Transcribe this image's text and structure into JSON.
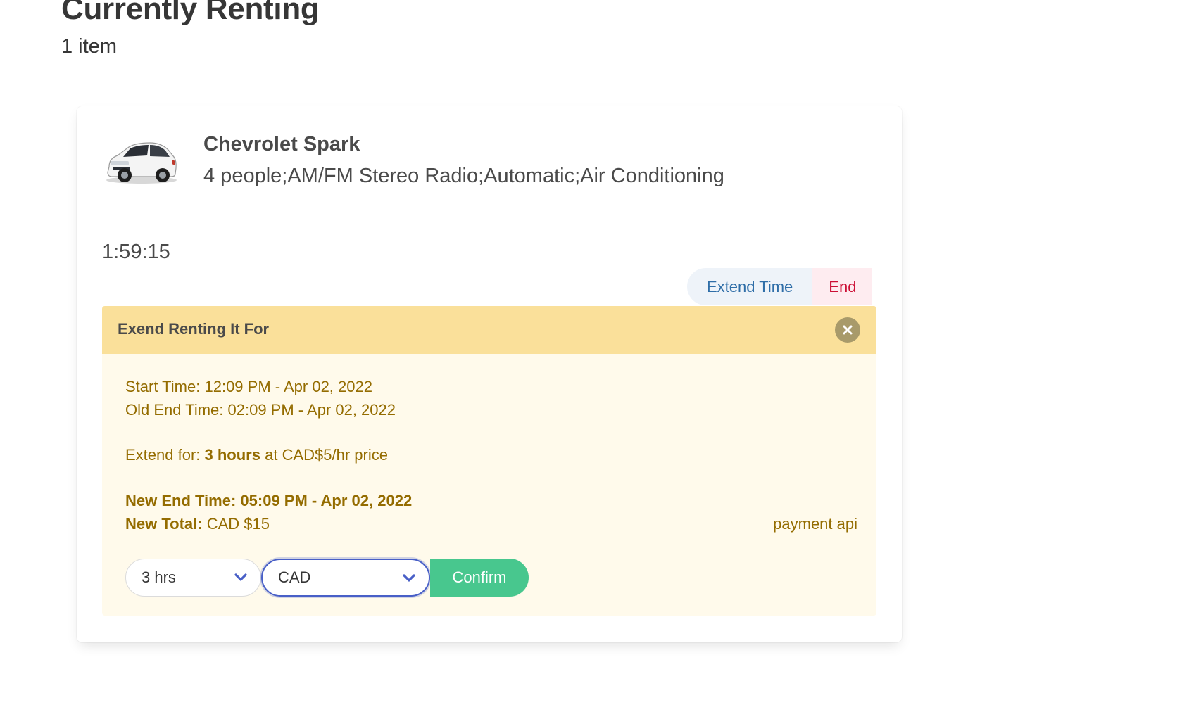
{
  "header": {
    "title": "Currently Renting",
    "subtitle": "1 item"
  },
  "rental": {
    "car_name": "Chevrolet Spark",
    "car_features": "4 people;AM/FM Stereo Radio;Automatic;Air Conditioning",
    "timer": "1:59:15"
  },
  "actions": {
    "extend_label": "Extend Time",
    "end_label": "End"
  },
  "extend_panel": {
    "title": "Exend Renting It For",
    "start_time_label": "Start Time:",
    "start_time_value": "12:09 PM - Apr 02, 2022",
    "old_end_label": "Old End Time:",
    "old_end_value": "02:09 PM - Apr 02, 2022",
    "extend_for_label": "Extend for:",
    "extend_for_value": "3 hours",
    "extend_for_suffix": "at CAD$5/hr price",
    "new_end_label": "New End Time:",
    "new_end_value": "05:09 PM - Apr 02, 2022",
    "new_total_label": "New Total:",
    "new_total_value": "CAD $15",
    "payment_note": "payment api",
    "hours_select": "3 hrs",
    "currency_select": "CAD",
    "confirm_label": "Confirm"
  },
  "colors": {
    "accent_blue": "#485fc7",
    "success": "#48c78e",
    "warning_header": "#fae09a",
    "warning_text": "#946c00",
    "danger": "#cc0f35"
  },
  "icons": {
    "close": "close-icon",
    "chevron": "chevron-down-icon",
    "car": "car-image"
  }
}
